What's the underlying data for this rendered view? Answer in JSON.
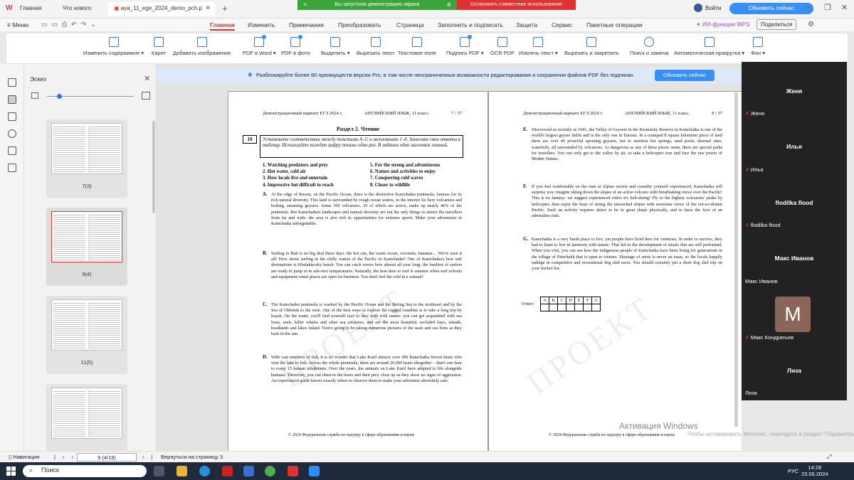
{
  "titlebar": {
    "tabs": [
      {
        "label": "Главная"
      },
      {
        "label": "Что нового"
      },
      {
        "label": "aya_11_ege_2024_demo_pch.p"
      }
    ],
    "share_banner": {
      "left": "Вы запустили демонстрацию экрана",
      "right": "Остановить совместное использование"
    },
    "login": "Войти",
    "update": "Обновить сейчас"
  },
  "menubar": {
    "menu_label": "Меню",
    "items": [
      "Главная",
      "Изменить",
      "Примечание",
      "Преобразовать",
      "Страница",
      "Заполнить и подписать",
      "Защита",
      "Сервис",
      "Пакетные операции"
    ],
    "wps_ai": "ИИ-функции WPS",
    "share": "Поделиться"
  },
  "ribbon": {
    "tools": [
      "Изменить содержимое",
      "Карет",
      "Добавить изображение",
      "PDF в Word",
      "PDF в фото",
      "Выделить",
      "Вырезать текст",
      "Текстовое поле",
      "Подпись PDF",
      "OCR PDF",
      "Извлечь текст",
      "Вырезать и закрепить",
      "Поиск и замена",
      "Автоматическая прокрутка",
      "Фон"
    ]
  },
  "thumbs": {
    "title": "Эскиз",
    "pages": [
      "7(3)",
      "9(4)",
      "11(5)"
    ]
  },
  "promo": {
    "text": "Разблокируйте более 80 преимуществ версии Pro, в том числе неограниченные возможности редактирования и сохранения файлов PDF без подписки.",
    "button": "Обновить сейчас"
  },
  "page_left": {
    "hdr_left": "Демонстрационный вариант ЕГЭ 2024 г.",
    "hdr_mid": "АНГЛИЙСКИЙ ЯЗЫК, 11 класс.",
    "hdr_right": "7 / 37",
    "section": "Раздел 2. Чтение",
    "qnum": "10",
    "qtext": "Установите соответствие между текстами A–G и заголовками 1–8. Занесите свои ответы в таблицу. Используйте каждую цифру только один раз. В задании один заголовок лишний.",
    "headings": [
      "1. Watching predators and prey",
      "2. Hot water, cold air",
      "3. How locals live and entertain",
      "4. Impressive but difficult to reach",
      "5. For the strong and adventurous",
      "6. Nature and activities to enjoy",
      "7. Conquering cold waves",
      "8. Closer to wildlife"
    ],
    "paraA": "At the edge of Russia, on the Pacific Ocean, there is the distinctive Kamchatka peninsula, famous for its rich natural diversity. This land is surrounded by rough ocean waters, in the interior lie fiery volcanoes and boiling, steaming geysers. Some 300 volcanoes, 29 of which are active, make up nearly 40% of the peninsula. But Kamchatka's landscapes and natural diversity are not the only things to attract the travellers from far and wide: the area is also rich in opportunities for extreme sports. Make your adventures in Kamchatka unforgettable.",
    "paraB": "Surfing in Bali is no big deal these days: the hot sun, the warm ocean, coconuts, bananas… We've seen it all! How about surfing in the chilly waters of the Pacific in Kamchatka? One of Kamchatka's best surf destinations is Khalaktyrsky beach. You can catch waves here almost all year long: the hardiest of surfers are ready to jump in in sub-zero temperatures. Naturally, the best time to surf is summer when surf schools and equipment rental places are open for business. You don't feel the cold in a wetsuit!",
    "paraC": "The Kamchatka peninsula is washed by the Pacific Ocean and the Bering Sea to the northeast and by the Sea of Okhotsk to the west. One of the best ways to explore the rugged coastline is to take a long trip by kayak. On the water, you'll find yourself face to face with wild nature: you can get acquainted with sea lions, seals, killer whales and other sea creatures, and see the most beautiful, secluded bays, islands, headlands and lakes inland. You're going to be taking numerous pictures of the seals and sea lions as they bask in the sun.",
    "paraD": "With vast numbers of fish, it is no wonder that Lake Kuril attracts over 200 Kamchatka brown bears who visit the lake to fish. Across the whole peninsula, there are around 20,000 bears altogether – that's one bear to every 15 human inhabitants. Over the years, the animals on Lake Kuril have adapted to life alongside humans. Therefore, you can observe the bears and their prey close up as they show no signs of aggression. An experienced guide knows exactly where to observe them to make your adventure absolutely safe.",
    "footer": "© 2024 Федеральная служба по надзору в сфере образования и науки"
  },
  "page_right": {
    "hdr_left": "Демонстрационный вариант ЕГЭ 2024 г.",
    "hdr_mid": "АНГЛИЙСКИЙ ЯЗЫК, 11 класс.",
    "hdr_right": "8 / 37",
    "paraE": "Discovered as recently as 1941, the Valley of Geysers in the Kronotsky Reserve in Kamchatka is one of the world's largest geyser fields and is the only one in Eurasia. In a cramped 8 square kilometer piece of land there are over 40 powerful spouting geysers, not to mention hot springs, mud pools, thermal sites, waterfalls, all surrounded by volcanoes. As dangerous as any of these places seem, there are special paths for travellers. You can only get to the valley by air, so take a helicopter tour and face the raw power of Mother Nature.",
    "paraF": "If you feel comfortable on the runs at Alpine resorts and consider yourself experienced, Kamchatka will surprise you: imagine skiing down the slopes of an active volcano with breathtaking views over the Pacific! This is no fantasy: we suggest experienced riders try heli-skiing! Fly to the highest volcanoes' peaks by helicopter, then enjoy the buzz of skiing the untouched slopes with awesome views of the not-so-distant Pacific. Such an activity requires skiers to be in great shape physically, and to have the love of an adrenaline rush.",
    "paraG": "Kamchatka is a very harsh place to live, yet people have lived here for centuries. In order to survive, they had to learn to live in harmony with nature. That led to the development of rituals that are still performed. When you visit, you can see how the indigenous people of Kamchatka have been living for generations in the village of Pimchakh that is open to visitors. Shortage of snow is never an issue, so the locals happily indulge in competitive and recreational dog sled races. You should certainly put a short dog sled trip on your bucket list.",
    "answer_label": "Ответ:",
    "answer_cols": [
      "A",
      "B",
      "C",
      "D",
      "E",
      "F",
      "G"
    ],
    "footer": "© 2024 Федеральная служба по надзору в сфере образования и науки"
  },
  "watermark": "ПРОЕКТ",
  "video": {
    "participants": [
      {
        "title": "Женя",
        "label": "Женя"
      },
      {
        "title": "Илья",
        "label": "Илья"
      },
      {
        "title": "flodilka flood",
        "label": "flodilka flood"
      },
      {
        "title": "Макс Иванов",
        "label": "Макс Иванов"
      },
      {
        "title": "",
        "label": "Макс Кондратьев",
        "avatar": "M"
      },
      {
        "title": "Лиза",
        "label": "Лиза"
      }
    ]
  },
  "status": {
    "nav": "Навигация",
    "page": "9 (4/19)",
    "back": "Вернуться на страницу 3"
  },
  "activation": {
    "title": "Активация Windows",
    "sub": "Чтобы активировать Windows, перейдите в раздел \"Параметры\"."
  },
  "taskbar": {
    "search": "Поиск",
    "lang": "РУС",
    "time": "14:28",
    "date": "23.06.2024"
  }
}
